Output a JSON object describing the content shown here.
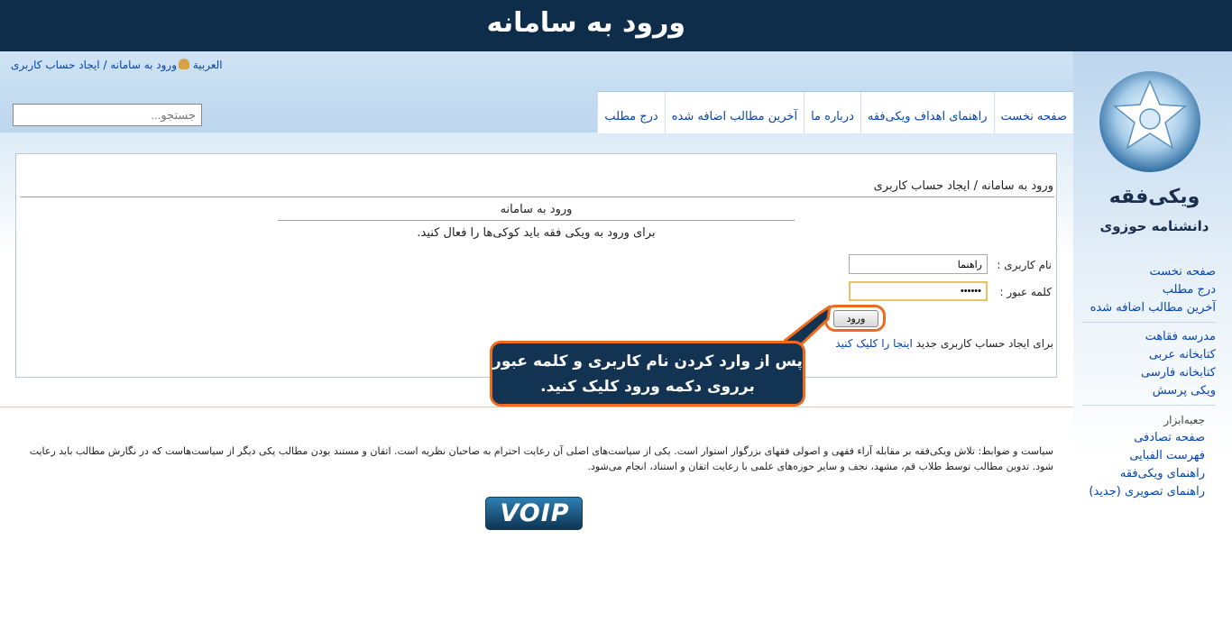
{
  "page": {
    "title": "ورود به سامانه"
  },
  "personal": {
    "login_link": "ورود به سامانه / ایجاد حساب کاربری",
    "language": "العربية"
  },
  "search": {
    "placeholder": "جستجو..."
  },
  "tabs": [
    {
      "label": "صفحه نخست"
    },
    {
      "label": "راهنمای اهداف ویکی‌فقه"
    },
    {
      "label": "درباره ما"
    },
    {
      "label": "آخرین مطالب اضافه شده"
    },
    {
      "label": "درج مطلب"
    }
  ],
  "logo": {
    "title": "ویکی‌فقه",
    "subtitle": "دانشنامه حوزوی"
  },
  "sidebar": {
    "main_links": [
      {
        "label": "صفحه نخست"
      },
      {
        "label": "درج مطلب"
      },
      {
        "label": "آخرین مطالب اضافه شده"
      }
    ],
    "site_links": [
      {
        "label": "مدرسه فقاهت"
      },
      {
        "label": "کتابخانه عربی"
      },
      {
        "label": "کتابخانه فارسی"
      },
      {
        "label": "ویکی پرسش"
      }
    ],
    "toolbox_heading": "جعبه‌ابزار",
    "toolbox_links": [
      {
        "label": "صفحه تصادفی"
      },
      {
        "label": "فهرست الفبایی"
      },
      {
        "label": "راهنمای ویکی‌فقه"
      },
      {
        "label": "راهنمای تصویری (جدید)"
      }
    ]
  },
  "content": {
    "breadcrumb": "ورود به سامانه / ایجاد حساب کاربری",
    "form_title": "ورود به سامانه",
    "cookie_notice": "برای ورود به ویکی فقه باید کوکی‌ها را فعال کنید.",
    "username_label": "نام کاربری :",
    "username_value": "راهنما",
    "password_label": "کلمه عبور :",
    "password_value": "••••••",
    "login_button": "ورود",
    "signup_text": "برای ایجاد حساب کاربری جدید",
    "signup_link": "اینجا را کلیک کنید"
  },
  "callout": {
    "line1": "پس از وارد کردن نام کاربری و کلمه عبور",
    "line2": "برروی دکمه ورود کلیک کنید."
  },
  "footer": {
    "policy": "سیاست و ضوابط: تلاش ویکی‌فقه بر مقابله آراء فقهی و اصولی فقهای بزرگوار استوار است. یکی از سیاست‌های اصلی آن رعایت احترام به صاحبان نظریه است. اتقان و مستند بودن مطالب یکی دیگر از سیاست‌هاست که در نگارش مطالب باید رعایت شود. تدوین مطالب توسط طلاب قم، مشهد، نجف و سایر حوزه‌های علمی با رعایت اتقان و استناد، انجام می‌شود.",
    "badge": "VOIP"
  },
  "colors": {
    "accent": "#ef6a1c",
    "header": "#0e2d4a",
    "link": "#0645ad"
  }
}
